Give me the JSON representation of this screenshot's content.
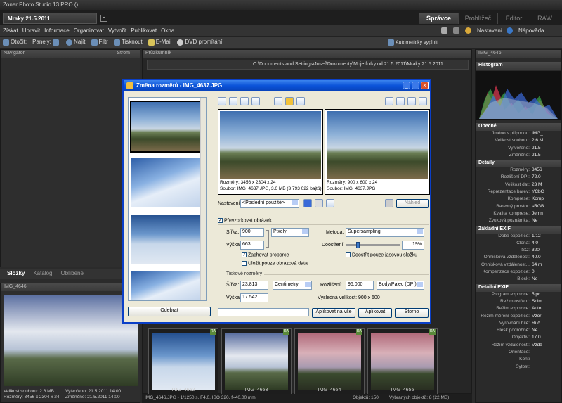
{
  "window": {
    "title": "Zoner Photo Studio 13 PRO  ()"
  },
  "doc_tab": {
    "label": "Mraky 21.5.2011"
  },
  "modes": [
    "Správce",
    "Prohlížeč",
    "Editor",
    "RAW"
  ],
  "menu": [
    "Získat",
    "Upravit",
    "Informace",
    "Organizovat",
    "Vytvořit",
    "Publikovat",
    "Okna"
  ],
  "menu_right": {
    "settings": "Nastavení",
    "help": "Nápověda"
  },
  "toolbar": {
    "rotate": "Otočit:",
    "panels": "Panely:",
    "find": "Najít",
    "filter": "Filtr",
    "print": "Tisknout",
    "email": "E-Mail",
    "dvd": "DVD promítání",
    "autofill": "Automaticky vyplnit"
  },
  "navigator": {
    "title": "Navigátor",
    "tree": "Strom"
  },
  "explorer": {
    "title": "Průzkumník",
    "path": "C:\\Documents and Settings\\Josef\\Dokumenty\\Moje fotky od 21.5.2011\\Mraky 21.5.2011"
  },
  "left_tabs": [
    "Složky",
    "Katalog",
    "Oblíbené"
  ],
  "preview": {
    "title": "IMG_4646",
    "file_size_label": "Velikost souboru: 2.6 MB",
    "created_label": "Vytvořeno: 21.5.2011 14:00",
    "dimensions_label": "Rozměry: 3456 x 2304 x 24",
    "modified_label": "Změněno: 21.5.2011 14:00"
  },
  "right_panel": {
    "title": "IMG_4646",
    "histogram": "Histogram",
    "sections": [
      {
        "name": "Obecné",
        "rows": [
          [
            "Jméno s příponou:",
            "IMG_"
          ],
          [
            "Velikost souboru:",
            "2.6 M"
          ],
          [
            "Vytvořeno:",
            "21.5"
          ],
          [
            "Změněno:",
            "21.5"
          ]
        ]
      },
      {
        "name": "Detaily",
        "rows": [
          [
            "Rozměry:",
            "3456"
          ],
          [
            "Rozlišení DPI:",
            "72.0"
          ],
          [
            "Velikost dat:",
            "23 M"
          ],
          [
            "Reprezentace barev:",
            "YCbC"
          ],
          [
            "Komprese:",
            "Komp"
          ],
          [
            "Barevný prostor:",
            "sRGB"
          ],
          [
            "Kvalita komprese:",
            "Jemn"
          ],
          [
            "Zvuková poznámka:",
            "Ne"
          ]
        ]
      },
      {
        "name": "Základní EXIF",
        "rows": [
          [
            "Doba expozice:",
            "1/12"
          ],
          [
            "Clona:",
            "4.0"
          ],
          [
            "ISO:",
            "320"
          ],
          [
            "Ohnisková vzdálenost:",
            "40.0"
          ],
          [
            "Ohnisková vzdálenost...",
            "64 m"
          ],
          [
            "Kompenzace expozice:",
            "0"
          ],
          [
            "Blesk:",
            "Ne"
          ]
        ]
      },
      {
        "name": "Detailní EXIF",
        "rows": [
          [
            "Program expozice:",
            "5 pr"
          ],
          [
            "Režim ostření:",
            "Snim"
          ],
          [
            "Režim expozice:",
            "Auto"
          ],
          [
            "Režim měření expozice:",
            "Vzor"
          ],
          [
            "Vyrovnání bílé:",
            "Ruč"
          ],
          [
            "Blesk podrobně:",
            "Ne"
          ],
          [
            "Objektiv:",
            "17.0"
          ],
          [
            "Režim vzdálenosti:",
            "Vzdá"
          ],
          [
            "Orientace:",
            ""
          ],
          [
            "Konti",
            ""
          ],
          [
            "Sytost:",
            ""
          ]
        ]
      }
    ]
  },
  "thumbs": [
    "IMG_4652",
    "IMG_4653",
    "IMG_4654",
    "IMG_4655"
  ],
  "status": {
    "info": "IMG_4646.JPG - 1/1250 s, F4.0, ISO 320, f=40.00 mm",
    "objects": "Objektů: 150",
    "selected": "Vybraných objektů: 8 (22 MB)"
  },
  "dialog": {
    "title": "Změna rozměrů - IMG_4637.JPG",
    "orig_dims": "Rozměry: 3456 x 2304 x 24",
    "orig_file": "Soubor: IMG_4637.JPG, 3.6 MB (3 793 022 bajtů)",
    "new_dims": "Rozměry: 900 x 600 x 24",
    "new_file": "Soubor: IMG_4637.JPG",
    "preset_label": "Nastavení:",
    "preset_value": "<Poslední použité>",
    "preview_btn": "Náhled",
    "resample_chk": "Převzorkovat obrázek",
    "width_label": "Šířka:",
    "width_value": "900",
    "height_label": "Výška:",
    "height_value": "663",
    "unit": "Pixely",
    "method_label": "Metoda:",
    "method_value": "Supersampling",
    "sharpen_label": "Doostření:",
    "sharpen_value": "19%",
    "sharpen_level": 19,
    "keep_ratio": "Zachovat proporce",
    "save_only_data": "Uložit pouze obrazová data",
    "sharpen_luma": "Doostřit pouze jasovou složku",
    "print_group": "Tiskové rozměry",
    "print_width_label": "Šířka:",
    "print_width_value": "23.813",
    "print_height_label": "Výška:",
    "print_height_value": "17.542",
    "print_unit": "Centimetry",
    "resolution_label": "Rozlišení:",
    "resolution_value": "96.000",
    "resolution_unit": "Body/Palec (DPI)",
    "result_size": "Výsledná velikost:  900 x 600",
    "remove_btn": "Odebrat",
    "apply_all_btn": "Aplikovat na vše",
    "apply_btn": "Aplikovat",
    "cancel_btn": "Storno"
  }
}
